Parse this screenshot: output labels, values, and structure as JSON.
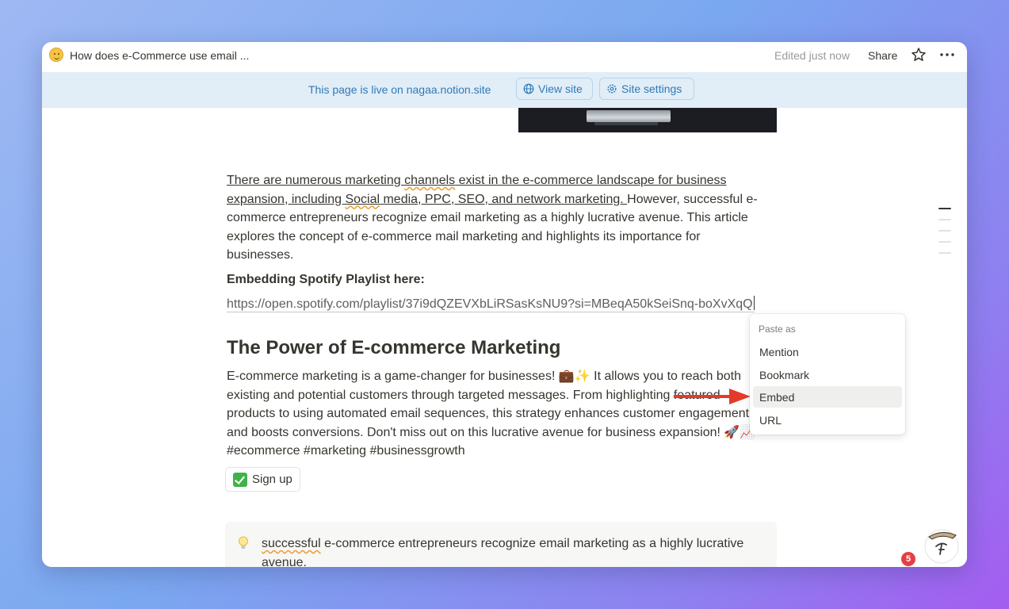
{
  "topbar": {
    "page_title": "How does e-Commerce use email ...",
    "edited": "Edited just now",
    "share": "Share"
  },
  "banner": {
    "text": "This page is live on nagaa.notion.site",
    "view_site": "View site",
    "site_settings": "Site settings"
  },
  "content": {
    "p1_link_a": "There are numerous marketing ",
    "p1_link_sq1": "channels",
    "p1_link_b": " exist in the e-commerce landscape for business expansion, including ",
    "p1_link_sq2": "Social",
    "p1_link_c": " media, PPC, SEO, and network marketing. ",
    "p1_rest": "However, successful e-commerce entrepreneurs recognize email marketing as a highly lucrative avenue. This article explores the concept of e-commerce mail marketing and highlights its importance for businesses.",
    "embed_heading": "Embedding Spotify Playlist here:",
    "url": "https://open.spotify.com/playlist/37i9dQZEVXbLiRSasKsNU9?si=MBeqA50kSeiSnq-boXvXqQ",
    "heading": "The Power of E-commerce Marketing",
    "p2_a": "E-commerce marketing is a game-changer for businesses! 💼✨ It allows you to reach both existing and potential customers through targeted messages. From highlighting ",
    "p2_strike": "featured",
    "p2_b": " products to using automated email sequences, this strategy enhances customer engagement and boosts conversions. Don't miss out on this lucrative avenue for business expansion! 🚀📈 #ecommerce #marketing #businessgrowth",
    "signup": "Sign up",
    "callout_sq": "successful",
    "callout_rest": " e-commerce entrepreneurs recognize email marketing as a highly lucrative avenue."
  },
  "paste_menu": {
    "header": "Paste as",
    "items": [
      "Mention",
      "Bookmark",
      "Embed",
      "URL"
    ],
    "selected": "Embed"
  },
  "notification_count": "5",
  "colors": {
    "accent": "#2f7ab7",
    "banner_bg": "#e1edf7",
    "arrow": "#e53a2a",
    "badge": "#e34045"
  },
  "icons": [
    "page-emoji-icon",
    "star-icon",
    "more-icon",
    "globe-icon",
    "gear-icon",
    "check-icon",
    "bulb-icon",
    "arrow-icon"
  ]
}
